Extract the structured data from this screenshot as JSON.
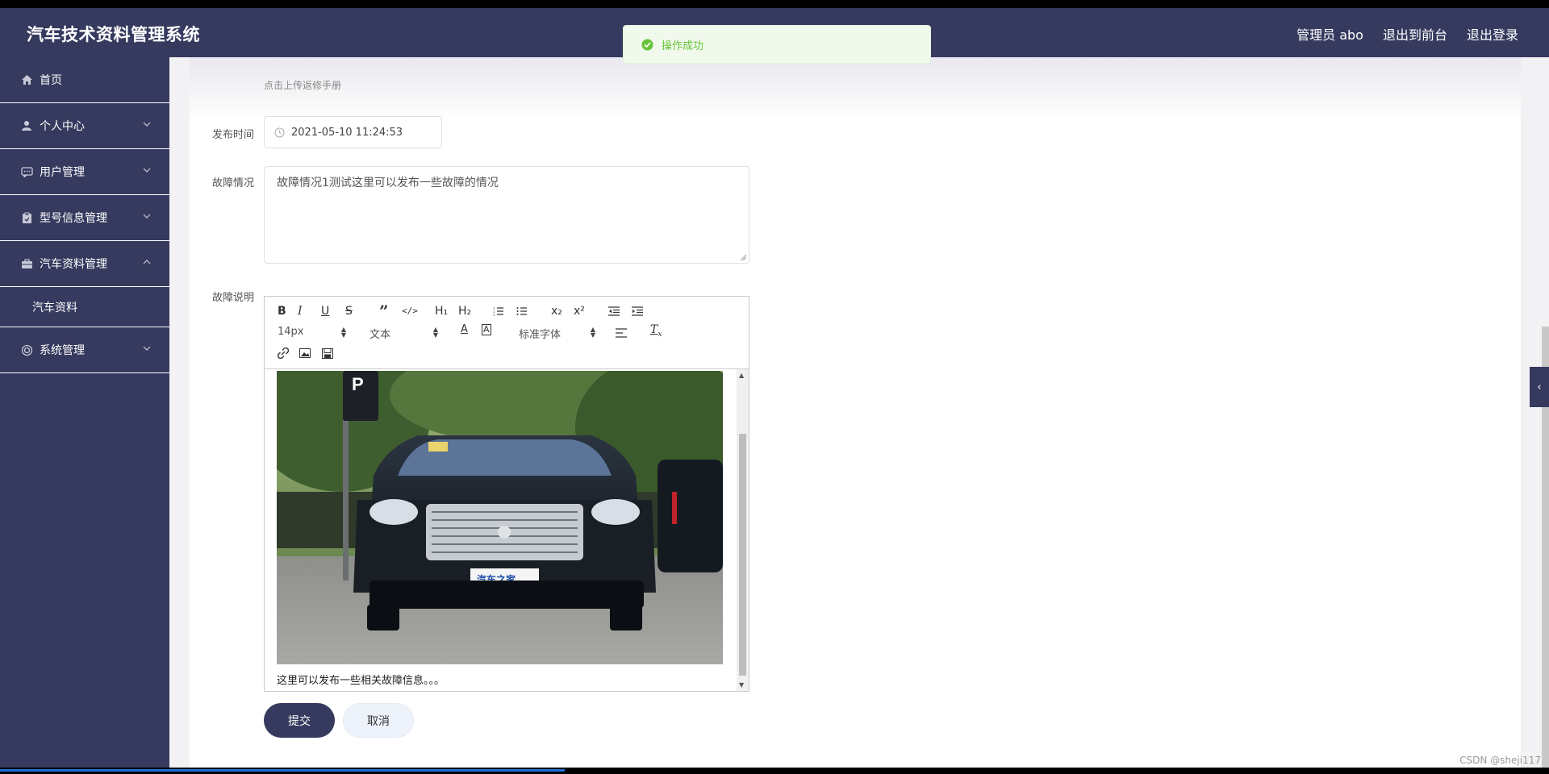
{
  "header": {
    "title": "汽车技术资料管理系统",
    "user": "管理员 abo",
    "to_front": "退出到前台",
    "logout": "退出登录"
  },
  "toast": {
    "message": "操作成功"
  },
  "sidebar": {
    "items": [
      {
        "label": "首页",
        "icon": "home-icon"
      },
      {
        "label": "个人中心",
        "icon": "user-icon"
      },
      {
        "label": "用户管理",
        "icon": "chat-icon"
      },
      {
        "label": "型号信息管理",
        "icon": "clipboard-icon"
      },
      {
        "label": "汽车资料管理",
        "icon": "briefcase-icon"
      },
      {
        "label": "系统管理",
        "icon": "settings-icon"
      }
    ],
    "subitem": "汽车资料"
  },
  "form": {
    "upload_tip": "点击上传返修手册",
    "publish_time_label": "发布时间",
    "publish_time_value": "2021-05-10 11:24:53",
    "fault_status_label": "故障情况",
    "fault_status_value": "故障情况1测试这里可以发布一些故障的情况",
    "fault_desc_label": "故障说明",
    "editor_text": "这里可以发布一些相关故障信息。。。",
    "submit": "提交",
    "cancel": "取消"
  },
  "editor_toolbar": {
    "font_size": "14px",
    "paragraph": "文本",
    "font_family": "标准字体",
    "bold": "B",
    "italic": "I",
    "underline": "U",
    "strike": "S",
    "h1": "H₁",
    "h2": "H₂",
    "sub": "x₂",
    "sup": "x²"
  },
  "watermark": "CSDN @sheji117",
  "colors": {
    "primary": "#363a5e",
    "success": "#67c23a"
  }
}
